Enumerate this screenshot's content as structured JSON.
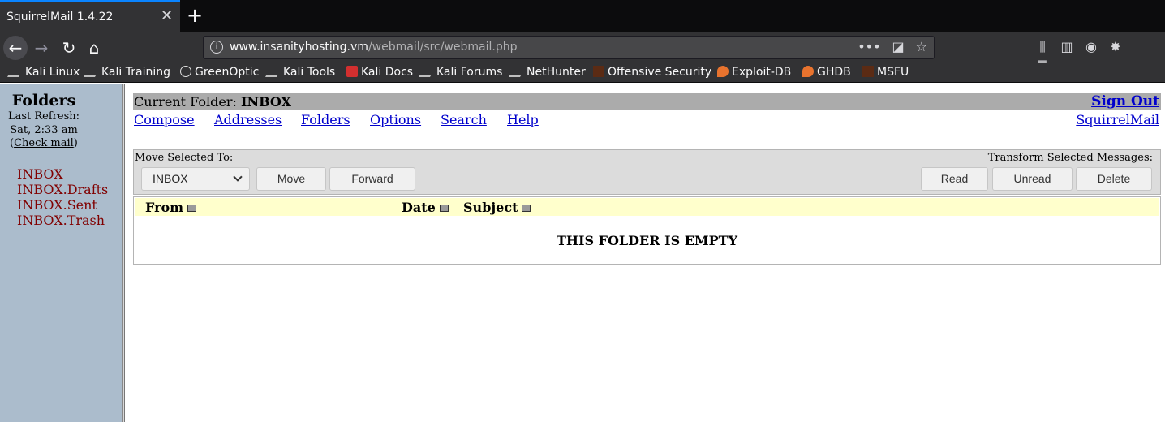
{
  "browser": {
    "tab_title": "SquirrelMail 1.4.22",
    "url_host": "www.insanityhosting.vm",
    "url_path": "/webmail/src/webmail.php",
    "bookmarks": [
      "Kali Linux",
      "Kali Training",
      "GreenOptic",
      "Kali Tools",
      "Kali Docs",
      "Kali Forums",
      "NetHunter",
      "Offensive Security",
      "Exploit-DB",
      "GHDB",
      "MSFU"
    ]
  },
  "left": {
    "title": "Folders",
    "last_refresh_label": "Last Refresh:",
    "last_refresh_time": "Sat, 2:33 am",
    "check_mail": "Check mail",
    "folders": [
      "INBOX",
      "INBOX.Drafts",
      "INBOX.Sent",
      "INBOX.Trash"
    ]
  },
  "main": {
    "current_folder_label": "Current Folder:",
    "current_folder": "INBOX",
    "sign_out": "Sign Out",
    "menu": [
      "Compose",
      "Addresses",
      "Folders",
      "Options",
      "Search",
      "Help"
    ],
    "brand_link": "SquirrelMail",
    "move_label": "Move Selected To:",
    "transform_label": "Transform Selected Messages:",
    "move_target": "INBOX",
    "buttons": {
      "move": "Move",
      "forward": "Forward",
      "read": "Read",
      "unread": "Unread",
      "delete": "Delete"
    },
    "columns": {
      "from": "From",
      "date": "Date",
      "subject": "Subject"
    },
    "empty_text": "THIS FOLDER IS EMPTY"
  },
  "colors": {
    "left_pane_bg": "#abbccc",
    "folder_link": "#800000",
    "title_bar_bg": "#ababab",
    "header_row_bg": "#ffffcc",
    "link": "#0000cc"
  }
}
